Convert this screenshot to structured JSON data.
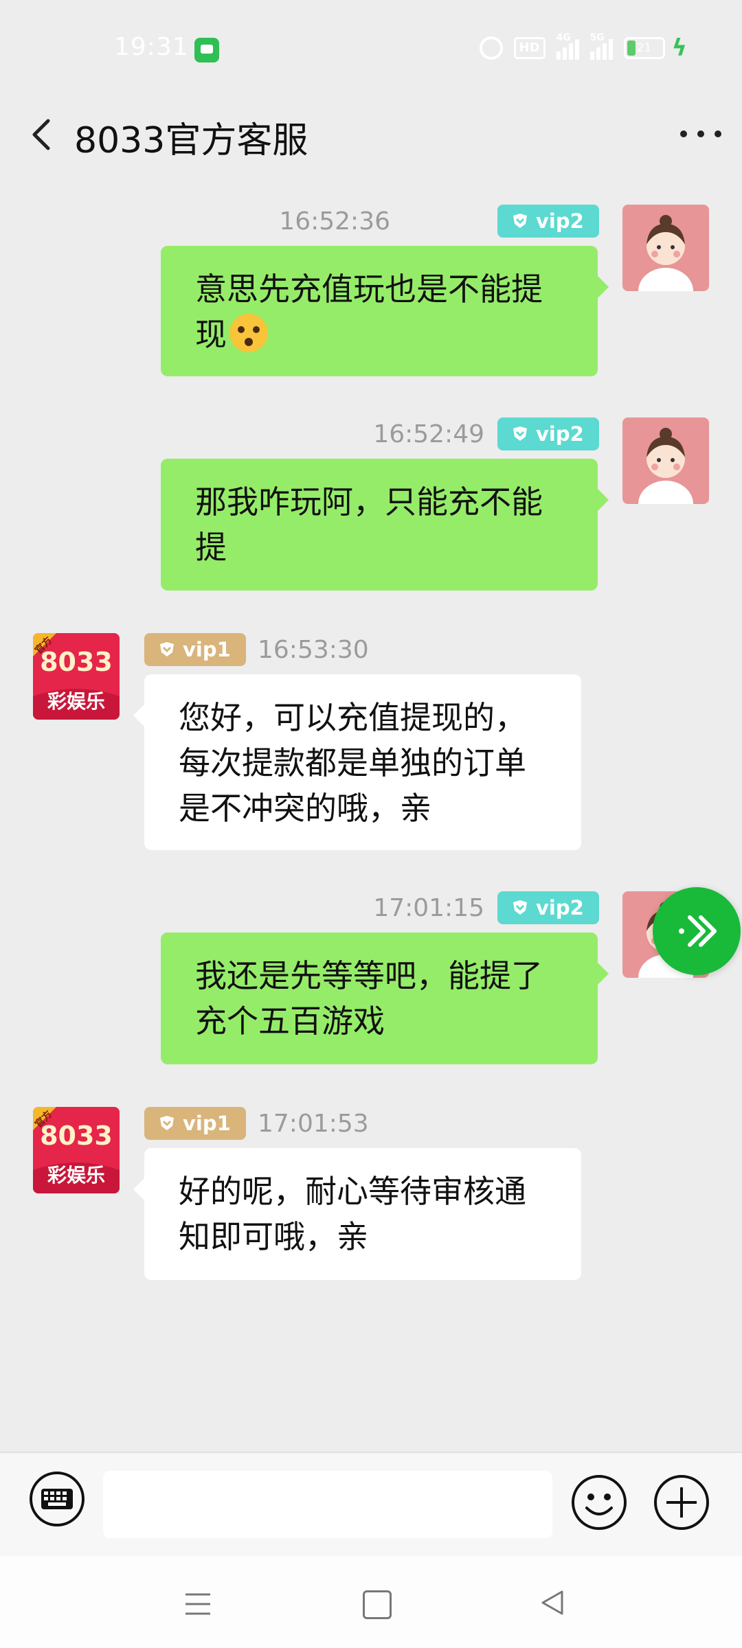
{
  "status_bar": {
    "time": "19:31",
    "hd_label": "HD",
    "signal1_label": "4G",
    "signal2_label": "5G",
    "battery_level": "21"
  },
  "header": {
    "title": "8033官方客服"
  },
  "official_avatar": {
    "corner_label": "官方",
    "number": "8033",
    "brand": "彩娱乐"
  },
  "messages": [
    {
      "side": "right",
      "time": "16:52:36",
      "vip": "vip2",
      "text": "意思先充值玩也是不能提现",
      "emoji": "flushed-face-emoji"
    },
    {
      "side": "right",
      "time": "16:52:49",
      "vip": "vip2",
      "text": "那我咋玩阿，只能充不能提"
    },
    {
      "side": "left",
      "time": "16:53:30",
      "vip": "vip1",
      "text": "您好，可以充值提现的，每次提款都是单独的订单是不冲突的哦，亲"
    },
    {
      "side": "right",
      "time": "17:01:15",
      "vip": "vip2",
      "text": "我还是先等等吧，能提了充个五百游戏"
    },
    {
      "side": "left",
      "time": "17:01:53",
      "vip": "vip1",
      "text": "好的呢，耐心等待审核通知即可哦，亲"
    }
  ],
  "input": {
    "placeholder": "",
    "value": ""
  },
  "colors": {
    "sent_bubble": "#95ec69",
    "received_bubble": "#ffffff",
    "vip2_badge": "#5cd9d0",
    "vip1_badge": "#d9b47b",
    "fab": "#19b93a"
  }
}
